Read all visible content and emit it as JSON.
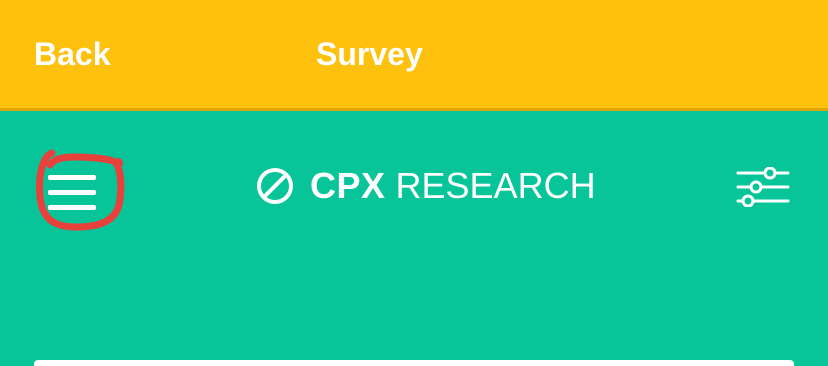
{
  "header": {
    "back_label": "Back",
    "title": "Survey",
    "background": "#fdc10e"
  },
  "navbar": {
    "background": "#07c598",
    "menu_icon": "hamburger-menu-icon",
    "menu_annotation_color": "#e8413c",
    "logo": {
      "icon": "cpx-logo-icon",
      "bold_text": "CPX",
      "text": "RESEARCH"
    },
    "filter_icon": "sliders-icon"
  }
}
